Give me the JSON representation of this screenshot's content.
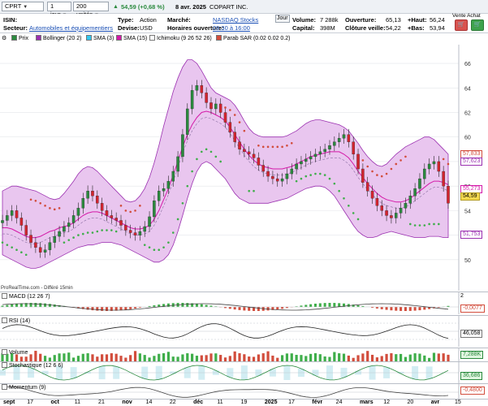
{
  "toolbar": {
    "ticker": "CPRT",
    "period": "1 jour",
    "units": "200 unités",
    "price_change": "54,59 (+0,68 %)",
    "date": "8 avr. 2025",
    "company": "COPART INC."
  },
  "info": {
    "isin_label": "ISIN:",
    "sector_label": "Secteur:",
    "sector_value": "Automobiles et équipementiers",
    "type_label": "Type:",
    "type_value": "Action",
    "currency_label": "Devise:",
    "currency_value": "USD",
    "market_label": "Marché:",
    "market_value": "NASDAQ Stocks",
    "hours_label": "Horaires ouverture:",
    "hours_value": "09:30 à 16:00",
    "day_tab": "Jour",
    "volume_label": "Volume:",
    "volume_value": "7 288k",
    "cap_label": "Capital:",
    "cap_value": "398M",
    "open_label": "Ouverture:",
    "open_value": "65,13",
    "prevclose_label": "Clôture veille:",
    "prevclose_value": "54,22",
    "high_label": "+Haut:",
    "high_value": "56,24",
    "low_label": "+Bas:",
    "low_value": "53,94",
    "sell_buy": "Vente Achat"
  },
  "legend": [
    {
      "label": "Prix",
      "color": "#2b8a3e"
    },
    {
      "label": "Bollinger (20 2)",
      "color": "#9b30b0"
    },
    {
      "label": "SMA (3)",
      "color": "#33c6ee"
    },
    {
      "label": "SMA (15)",
      "color": "#d41aa8"
    },
    {
      "label": "Ichimoku (9 26 52 26)",
      "color": "#ffffff"
    },
    {
      "label": "Parab SAR (0.02 0.02 0.2)",
      "color": "#d24d3c"
    }
  ],
  "attribution": "ProRealTime.com - Différé 15min",
  "panels": {
    "macd": {
      "label": "MACD (12 26 7)",
      "value": "-0,0077"
    },
    "rsi": {
      "label": "RSI (14)",
      "value": "46,058"
    },
    "volume": {
      "label": "Volume",
      "value": "7,288K"
    },
    "stoch": {
      "label": "Stochastique (12 6 6)",
      "value": "36,686"
    },
    "momentum": {
      "label": "Momentum (9)",
      "value": "-0,4800"
    }
  },
  "price_tags": {
    "t1": "57,833",
    "t2": "57,623",
    "t3": "55,273",
    "t4": "54,59",
    "t5": "51,753"
  },
  "chart_data": {
    "type": "candlestick",
    "y_ticks": [
      "66",
      "64",
      "62",
      "60",
      "58",
      "56",
      "54",
      "52",
      "50"
    ],
    "ylim": [
      48,
      67
    ],
    "x_labels": [
      "sept",
      "17",
      "oct",
      "11",
      "21",
      "nov",
      "14",
      "22",
      "déc",
      "11",
      "19",
      "2025",
      "17",
      "févr",
      "24",
      "mars",
      "12",
      "20",
      "avr",
      "15"
    ],
    "close": [
      53.2,
      53.6,
      54.0,
      53.4,
      52.8,
      52.0,
      51.4,
      51.0,
      50.6,
      50.8,
      51.4,
      51.9,
      52.3,
      52.7,
      53.0,
      53.6,
      54.2,
      55.0,
      55.6,
      55.2,
      54.6,
      54.0,
      53.6,
      53.4,
      53.2,
      52.8,
      52.4,
      52.2,
      52.0,
      52.3,
      52.7,
      53.5,
      54.8,
      55.6,
      55.8,
      56.4,
      57.2,
      58.4,
      60.2,
      62.3,
      63.8,
      64.2,
      63.6,
      62.8,
      62.3,
      62.7,
      62.0,
      61.2,
      60.4,
      59.6,
      59.0,
      58.8,
      58.6,
      58.3,
      57.7,
      57.2,
      56.8,
      56.6,
      56.4,
      56.6,
      57.0,
      57.4,
      57.8,
      58.0,
      58.2,
      58.4,
      58.6,
      58.8,
      59.0,
      59.3,
      59.6,
      59.9,
      60.2,
      59.6,
      58.6,
      57.4,
      56.3,
      55.6,
      55.0,
      54.4,
      54.0,
      53.6,
      53.4,
      53.8,
      54.2,
      54.6,
      55.2,
      55.8,
      56.6,
      57.4,
      57.8,
      58.0,
      57.2,
      56.0,
      54.6
    ],
    "bollinger_upper": [
      55.6,
      55.8,
      56.0,
      56.0,
      55.9,
      55.8,
      55.7,
      55.6,
      55.4,
      55.2,
      55.0,
      54.9,
      55.0,
      55.4,
      55.9,
      56.4,
      57.0,
      57.4,
      57.6,
      57.5,
      57.2,
      56.8,
      56.4,
      56.0,
      55.6,
      55.2,
      54.8,
      54.7,
      54.8,
      55.2,
      55.8,
      56.7,
      57.9,
      59.3,
      60.9,
      62.3,
      63.7,
      64.8,
      65.7,
      66.3,
      66.3,
      66.0,
      65.4,
      64.7,
      64.0,
      63.6,
      63.4,
      63.2,
      63.0,
      62.6,
      62.0,
      61.3,
      60.7,
      60.3,
      60.1,
      60.0,
      60.0,
      60.0,
      60.0,
      60.0,
      60.1,
      60.3,
      60.5,
      60.8,
      61.1,
      61.3,
      61.4,
      61.4,
      61.3,
      61.2,
      61.1,
      61.0,
      60.8,
      60.5,
      60.0,
      59.5,
      58.9,
      58.4,
      58.0,
      57.7,
      57.6,
      57.8,
      58.2,
      58.6,
      58.9,
      59.2,
      59.4,
      59.6,
      59.8,
      60.0,
      60.0,
      59.8,
      59.4,
      59.0,
      58.6
    ],
    "bollinger_lower": [
      50.4,
      50.2,
      50.0,
      49.8,
      49.6,
      49.4,
      49.3,
      49.3,
      49.4,
      49.6,
      49.8,
      50.0,
      50.2,
      50.4,
      50.6,
      50.8,
      51.0,
      51.1,
      51.2,
      51.2,
      51.3,
      51.4,
      51.4,
      51.4,
      51.3,
      51.2,
      51.0,
      50.8,
      50.6,
      50.4,
      50.2,
      50.0,
      49.8,
      49.8,
      50.0,
      50.4,
      51.2,
      52.3,
      53.6,
      55.0,
      56.2,
      57.2,
      57.8,
      58.0,
      57.8,
      57.4,
      57.0,
      56.6,
      56.0,
      55.4,
      55.0,
      54.8,
      54.6,
      54.6,
      54.6,
      54.6,
      54.6,
      54.7,
      54.8,
      54.9,
      55.0,
      55.2,
      55.4,
      55.6,
      55.8,
      55.9,
      56.0,
      56.0,
      55.9,
      55.6,
      55.2,
      54.6,
      54.0,
      53.4,
      52.8,
      52.3,
      52.0,
      51.8,
      51.8,
      51.9,
      52.1,
      52.2,
      52.3,
      52.2,
      52.1,
      52.0,
      51.9,
      51.8,
      51.8,
      51.8,
      51.9,
      51.9,
      51.9,
      51.8,
      51.8
    ],
    "sma15": [
      52.6,
      52.6,
      52.5,
      52.3,
      52.1,
      51.9,
      51.8,
      51.8,
      51.9,
      52.1,
      52.3,
      52.4,
      52.6,
      52.7,
      52.8,
      53.0,
      53.3,
      53.6,
      53.8,
      53.9,
      53.9,
      53.8,
      53.6,
      53.4,
      53.2,
      53.0,
      52.8,
      52.6,
      52.5,
      52.5,
      52.6,
      52.8,
      53.3,
      54.0,
      54.9,
      55.8,
      56.9,
      58.0,
      59.2,
      60.2,
      61.0,
      61.6,
      62.0,
      62.1,
      62.0,
      61.8,
      61.6,
      61.3,
      60.8,
      60.2,
      59.6,
      59.0,
      58.5,
      58.1,
      57.8,
      57.6,
      57.5,
      57.4,
      57.4,
      57.4,
      57.5,
      57.6,
      57.8,
      58.0,
      58.2,
      58.4,
      58.5,
      58.6,
      58.7,
      58.8,
      58.8,
      58.8,
      58.6,
      58.3,
      57.8,
      57.2,
      56.7,
      56.2,
      55.8,
      55.4,
      55.1,
      54.9,
      54.8,
      54.7,
      54.7,
      54.8,
      55.0,
      55.3,
      55.6,
      55.9,
      56.2,
      56.4,
      56.4,
      56.3,
      56.1
    ]
  }
}
